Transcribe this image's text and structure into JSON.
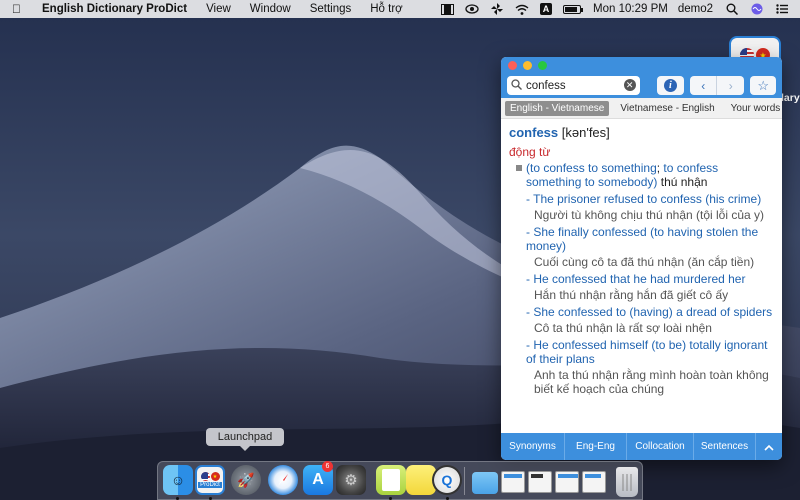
{
  "menubar": {
    "app_name": "English Dictionary ProDict",
    "menus": [
      "View",
      "Window",
      "Settings",
      "Hỗ trợ"
    ],
    "status_icons": [
      "film-icon",
      "eye-icon",
      "pinwheel-icon",
      "wifi-icon",
      "keyboard-a-icon",
      "battery-icon"
    ],
    "keyboard_badge": "A",
    "battery_percent": 85,
    "clock": "Mon 10:29 PM",
    "user": "demo2"
  },
  "desktop": {
    "icon_label": "lary"
  },
  "dictionary": {
    "search": {
      "value": "confess",
      "placeholder": ""
    },
    "tabs": [
      {
        "label": "English - Vietnamese",
        "active": true
      },
      {
        "label": "Vietnamese - English",
        "active": false
      },
      {
        "label": "Your words",
        "active": false
      }
    ],
    "entry": {
      "headword": "confess",
      "pronunciation": "[kən'fes]",
      "part_of_speech": "động từ",
      "sense": {
        "open_paren": "(",
        "usage_a": "to confess to something",
        "sep": "; ",
        "usage_b": "to confess something to somebody",
        "close_paren": ")",
        "meaning": " thú nhận"
      },
      "examples": [
        {
          "en_main": "- The prisoner refused to confess ",
          "en_paren": "(his crime)",
          "vi": "Người tù không chịu thú nhận (tội lỗi của y)"
        },
        {
          "en_main": "- She finally confessed ",
          "en_paren": "(to having stolen the money)",
          "vi": "Cuối cùng cô ta đã thú nhận (ăn cắp tiền)"
        },
        {
          "en_main": "- He confessed that he had murdered her",
          "en_paren": "",
          "vi": "Hắn thú nhận rằng hắn đã giết cô ấy"
        },
        {
          "en_main": "- She confessed to ",
          "en_paren": "(having) a dread of spiders",
          "vi": "Cô ta thú nhận là rất sợ loài nhện"
        },
        {
          "en_main": "- He confessed himself ",
          "en_paren": "(to be) totally ignorant of their plans",
          "vi": "Anh ta thú nhận rằng mình hoàn toàn không biết kế hoạch của chúng"
        }
      ]
    },
    "bottom_buttons": [
      "Synonyms",
      "Eng-Eng",
      "Collocation",
      "Sentences"
    ]
  },
  "tooltip": "Launchpad",
  "dock": {
    "app_store_badge": "6",
    "items": [
      "finder-icon",
      "prodict-icon",
      "launchpad-icon",
      "safari-icon",
      "app-store-icon",
      "system-preferences-icon",
      "notes-icon",
      "stickies-icon",
      "quicktime-icon",
      "downloads-folder-icon",
      "window-thumbnail-icon",
      "trash-icon"
    ],
    "prodict_label": "ProDict"
  },
  "colors": {
    "accent": "#3d8fdd",
    "headword": "#2164b0",
    "pos": "#c8282c"
  }
}
